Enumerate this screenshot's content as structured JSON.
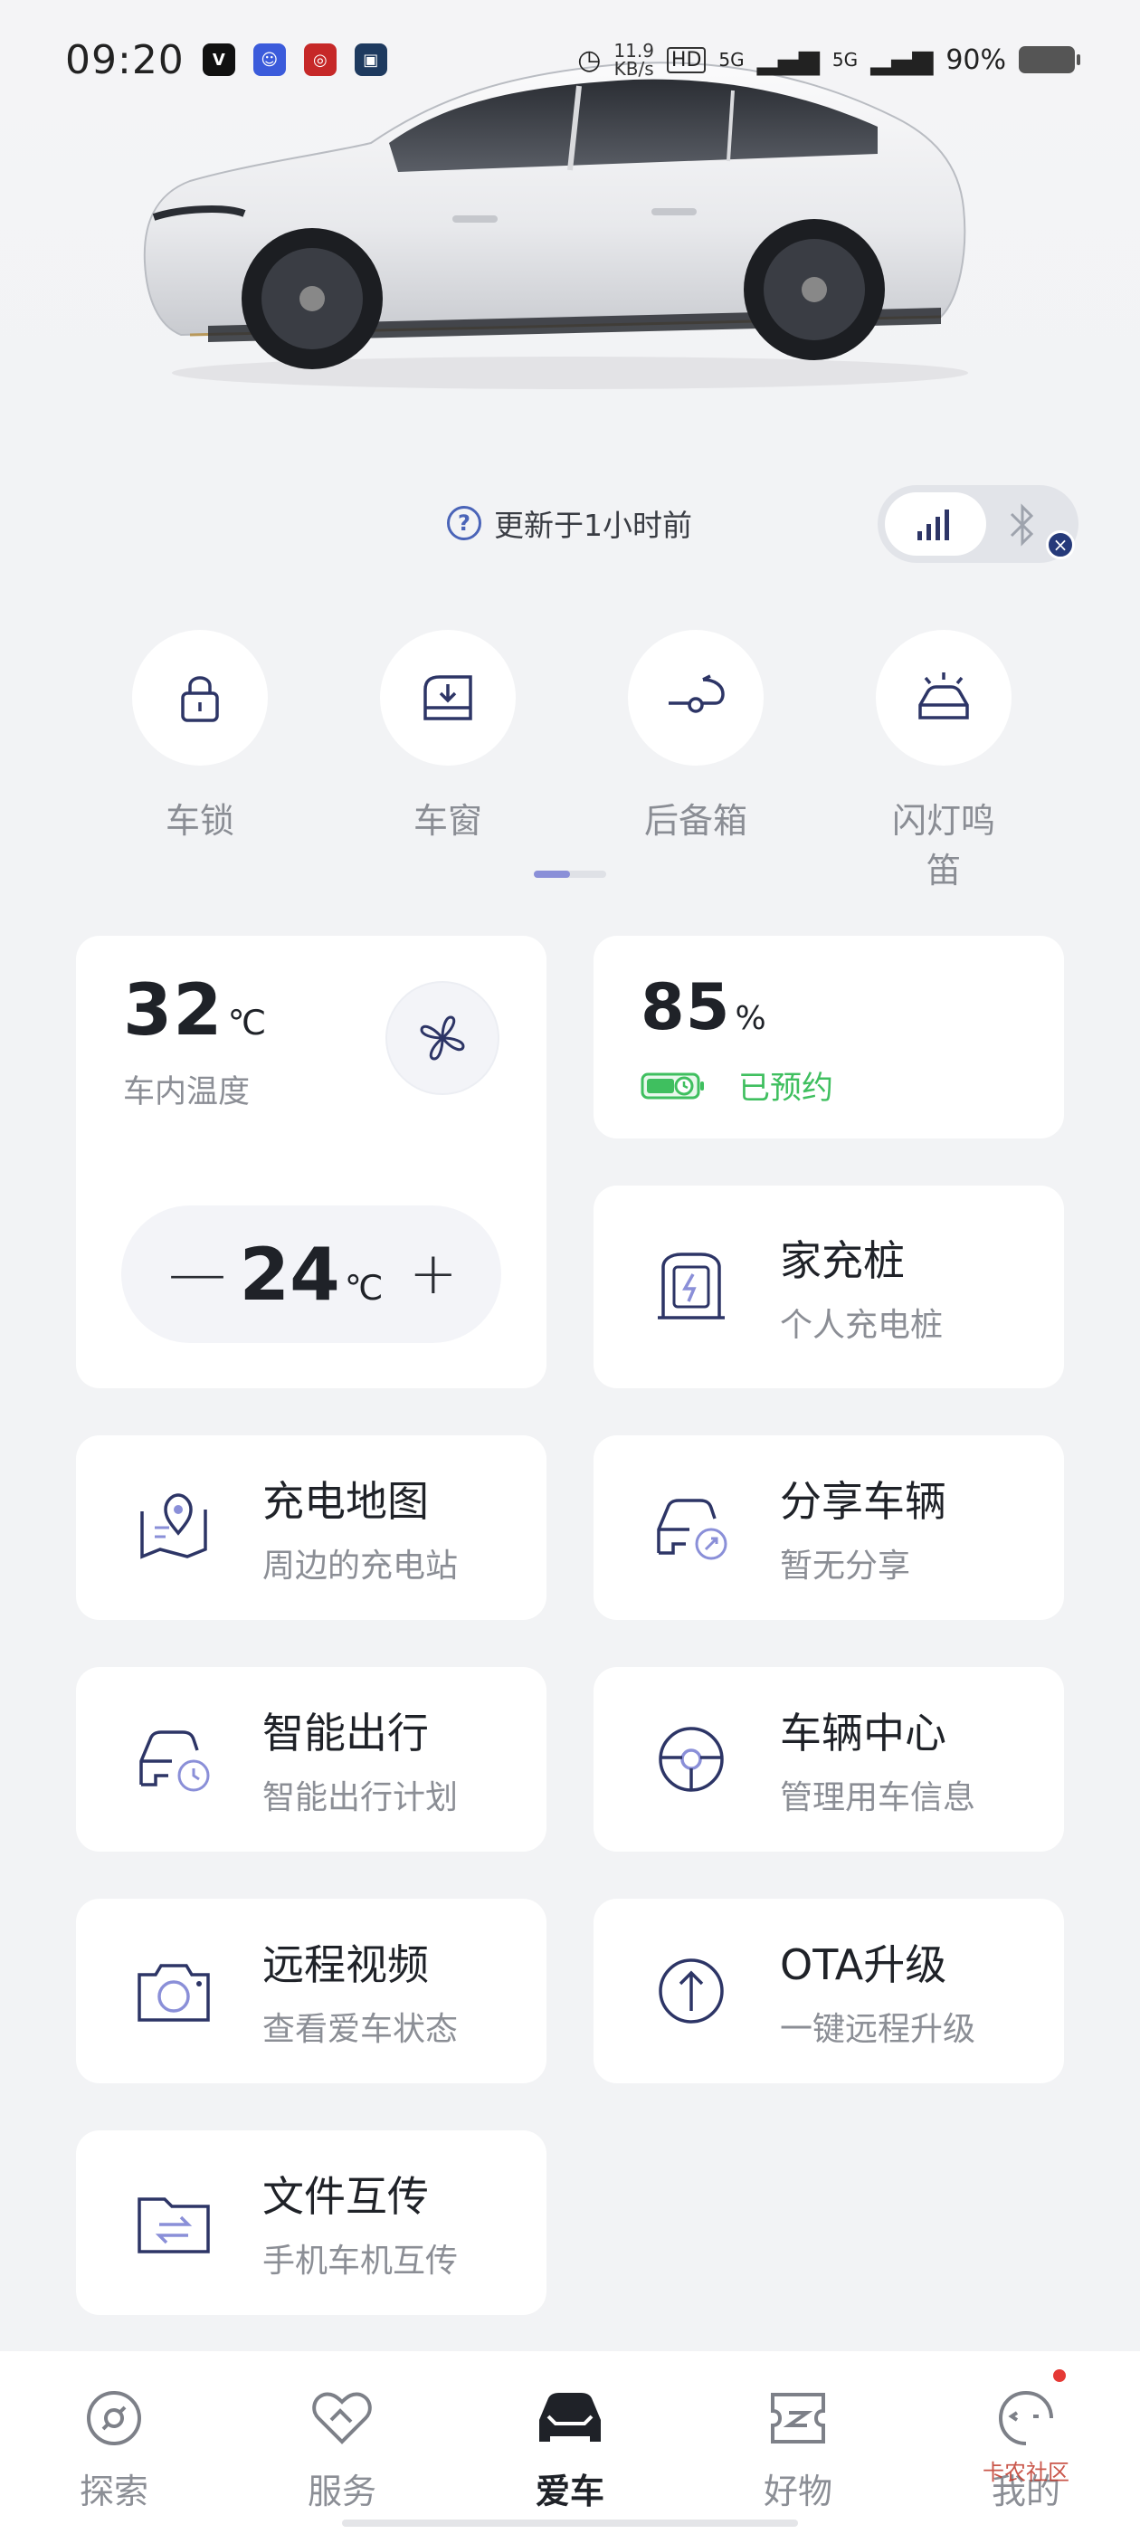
{
  "status_bar": {
    "time": "09:20",
    "net_speed_value": "11.9",
    "net_speed_unit": "KB/s",
    "hd_label": "HD",
    "signal1_label": "5G",
    "signal2_label": "5G",
    "battery": "90%"
  },
  "update": {
    "text": "更新于1小时前"
  },
  "quick_actions": [
    {
      "label": "车锁"
    },
    {
      "label": "车窗"
    },
    {
      "label": "后备箱"
    },
    {
      "label": "闪灯鸣笛"
    }
  ],
  "climate": {
    "cabin_temp": "32",
    "cabin_temp_unit": "℃",
    "cabin_temp_label": "车内温度",
    "set_temp": "24",
    "set_temp_unit": "℃",
    "minus_label": "—",
    "plus_label": "+"
  },
  "battery_card": {
    "value": "85",
    "unit": "%",
    "status": "已预约"
  },
  "tiles": {
    "home_charger": {
      "title": "家充桩",
      "subtitle": "个人充电桩"
    },
    "charging_map": {
      "title": "充电地图",
      "subtitle": "周边的充电站"
    },
    "share_vehicle": {
      "title": "分享车辆",
      "subtitle": "暂无分享"
    },
    "smart_trip": {
      "title": "智能出行",
      "subtitle": "智能出行计划"
    },
    "vehicle_center": {
      "title": "车辆中心",
      "subtitle": "管理用车信息"
    },
    "remote_video": {
      "title": "远程视频",
      "subtitle": "查看爱车状态"
    },
    "ota": {
      "title": "OTA升级",
      "subtitle": "一键远程升级"
    },
    "file_transfer": {
      "title": "文件互传",
      "subtitle": "手机车机互传"
    }
  },
  "bottom_nav": [
    {
      "label": "探索"
    },
    {
      "label": "服务"
    },
    {
      "label": "爱车"
    },
    {
      "label": "好物"
    },
    {
      "label": "我的"
    }
  ],
  "watermark": "卡农社区",
  "colors": {
    "accent_blue": "#4a64b8",
    "charging_green": "#3fbf5f",
    "page_bg": "#f2f3f5",
    "icon_stroke": "#2d3566"
  }
}
